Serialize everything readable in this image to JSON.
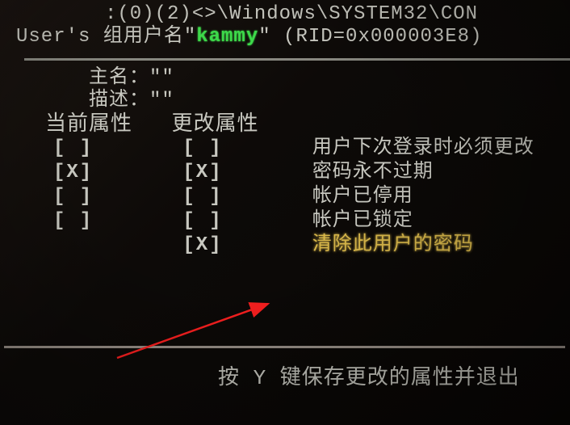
{
  "header": {
    "line1_prefix": ":(0)(2)<>\\Windows\\SYSTEM32\\CON",
    "line2_prefix": "User's 组用户名\"",
    "username": "kammy",
    "line2_suffix": "\" (RID=0x000003E8)"
  },
  "fields": {
    "name_label": "主名：",
    "name_value": "\"\"",
    "desc_label": "描述：",
    "desc_value": "\"\""
  },
  "table": {
    "col_current": "当前属性",
    "col_change": "更改属性",
    "rows": [
      {
        "current": "[ ]",
        "change": "[ ]",
        "label": "用户下次登录时必须更改",
        "highlight": false
      },
      {
        "current": "[X]",
        "change": "[X]",
        "label": "密码永不过期",
        "highlight": false
      },
      {
        "current": "[ ]",
        "change": "[ ]",
        "label": "帐户已停用",
        "highlight": false
      },
      {
        "current": "[ ]",
        "change": "[ ]",
        "label": "帐户已锁定",
        "highlight": false
      },
      {
        "current": "",
        "change": "[X]",
        "label": "清除此用户的密码",
        "highlight": true
      }
    ]
  },
  "footer": {
    "text": "按 Y 键保存更改的属性并退出"
  }
}
